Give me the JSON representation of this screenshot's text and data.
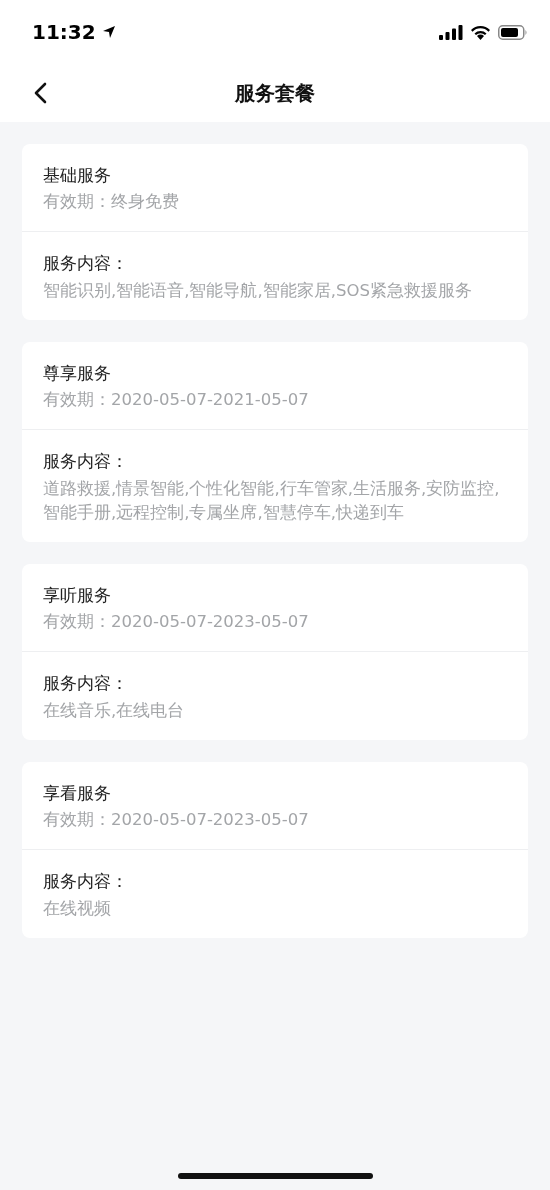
{
  "status_bar": {
    "time": "11:32"
  },
  "nav": {
    "title": "服务套餐"
  },
  "packages": [
    {
      "name": "基础服务",
      "validity": "有效期：终身免费",
      "content_label": "服务内容：",
      "content": "智能识别,智能语音,智能导航,智能家居,SOS紧急救援服务"
    },
    {
      "name": "尊享服务",
      "validity": "有效期：2020-05-07-2021-05-07",
      "content_label": "服务内容：",
      "content": "道路救援,情景智能,个性化智能,行车管家,生活服务,安防监控,智能手册,远程控制,专属坐席,智慧停车,快递到车"
    },
    {
      "name": "享听服务",
      "validity": "有效期：2020-05-07-2023-05-07",
      "content_label": "服务内容：",
      "content": "在线音乐,在线电台"
    },
    {
      "name": "享看服务",
      "validity": "有效期：2020-05-07-2023-05-07",
      "content_label": "服务内容：",
      "content": "在线视频"
    }
  ]
}
